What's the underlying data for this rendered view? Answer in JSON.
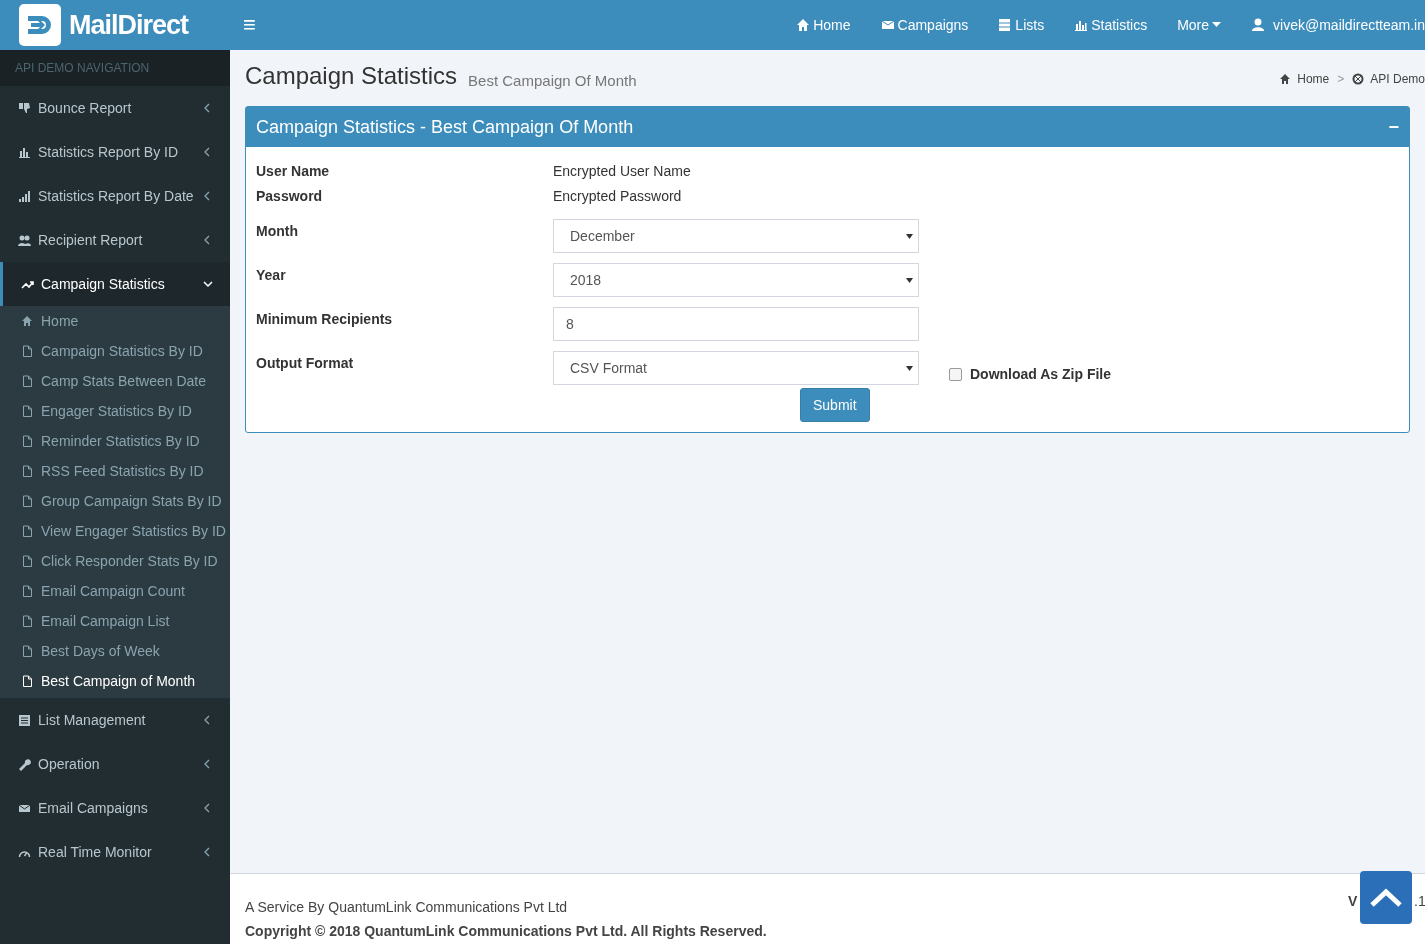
{
  "brand": {
    "name": "MailDirect"
  },
  "topbar": {
    "menu_icon": "≡",
    "items": [
      {
        "label": "Home"
      },
      {
        "label": "Campaigns"
      },
      {
        "label": "Lists"
      },
      {
        "label": "Statistics"
      },
      {
        "label": "More",
        "dropdown": true
      },
      {
        "label": "vivek@maildirectteam.in"
      }
    ]
  },
  "sidebar": {
    "header": "API DEMO NAVIGATION",
    "items": [
      {
        "label": "Bounce Report",
        "expanded": false
      },
      {
        "label": "Statistics Report By ID",
        "expanded": false
      },
      {
        "label": "Statistics Report By Date",
        "expanded": false
      },
      {
        "label": "Recipient Report",
        "expanded": false
      },
      {
        "label": "Campaign Statistics",
        "expanded": true,
        "children": [
          {
            "label": "Home",
            "selected": false
          },
          {
            "label": "Campaign Statistics By ID",
            "selected": false
          },
          {
            "label": "Camp Stats Between Date",
            "selected": false
          },
          {
            "label": "Engager Statistics By ID",
            "selected": false
          },
          {
            "label": "Reminder Statistics By ID",
            "selected": false
          },
          {
            "label": "RSS Feed Statistics By ID",
            "selected": false
          },
          {
            "label": "Group Campaign Stats By ID",
            "selected": false
          },
          {
            "label": "View Engager Statistics By ID",
            "selected": false
          },
          {
            "label": "Click Responder Stats By ID",
            "selected": false
          },
          {
            "label": "Email Campaign Count",
            "selected": false
          },
          {
            "label": "Email Campaign List",
            "selected": false
          },
          {
            "label": "Best Days of Week",
            "selected": false
          },
          {
            "label": "Best Campaign of Month",
            "selected": true
          }
        ]
      },
      {
        "label": "List Management",
        "expanded": false
      },
      {
        "label": "Operation",
        "expanded": false
      },
      {
        "label": "Email Campaigns",
        "expanded": false
      },
      {
        "label": "Real Time Monitor",
        "expanded": false
      }
    ]
  },
  "page": {
    "title": "Campaign Statistics",
    "subtitle": "Best Campaign Of Month",
    "breadcrumb": [
      {
        "label": "Home"
      },
      {
        "label": "API Demo"
      }
    ],
    "breadcrumb_separator": ">"
  },
  "panel": {
    "title": "Campaign Statistics - Best Campaign Of Month",
    "collapse": "−",
    "fields": [
      {
        "kind": "text",
        "label": "User Name",
        "value": "Encrypted User Name"
      },
      {
        "kind": "text",
        "label": "Password",
        "value": "Encrypted Password"
      },
      {
        "kind": "select",
        "label": "Month",
        "value": "December"
      },
      {
        "kind": "select",
        "label": "Year",
        "value": "2018"
      },
      {
        "kind": "input",
        "label": "Minimum Recipients",
        "value": "8"
      },
      {
        "kind": "select",
        "label": "Output Format",
        "value": "CSV Format",
        "checkbox": {
          "label": "Download As Zip File",
          "checked": false
        }
      }
    ],
    "submit": "Submit"
  },
  "footer": {
    "line_1": "A Service By QuantumLink Communications Pvt Ltd",
    "line_2": "Copyright © 2018 QuantumLink Communications Pvt Ltd. All Rights Reserved.",
    "version_left": "V",
    "version_right": ".1"
  }
}
